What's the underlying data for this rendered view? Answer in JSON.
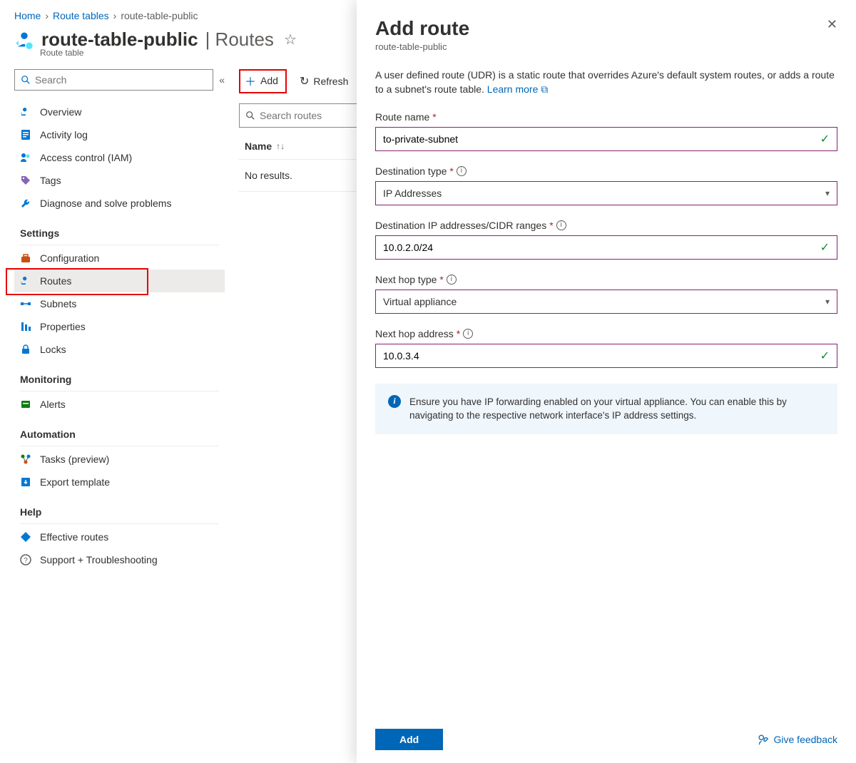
{
  "breadcrumb": {
    "home": "Home",
    "route_tables": "Route tables",
    "current": "route-table-public"
  },
  "header": {
    "title": "route-table-public",
    "divider": " | ",
    "subtitle": "Routes",
    "resource_type": "Route table"
  },
  "sidebar": {
    "search_placeholder": "Search",
    "items": [
      {
        "label": "Overview"
      },
      {
        "label": "Activity log"
      },
      {
        "label": "Access control (IAM)"
      },
      {
        "label": "Tags"
      },
      {
        "label": "Diagnose and solve problems"
      }
    ],
    "settings_header": "Settings",
    "settings": [
      {
        "label": "Configuration"
      },
      {
        "label": "Routes"
      },
      {
        "label": "Subnets"
      },
      {
        "label": "Properties"
      },
      {
        "label": "Locks"
      }
    ],
    "monitoring_header": "Monitoring",
    "monitoring": [
      {
        "label": "Alerts"
      }
    ],
    "automation_header": "Automation",
    "automation": [
      {
        "label": "Tasks (preview)"
      },
      {
        "label": "Export template"
      }
    ],
    "help_header": "Help",
    "help": [
      {
        "label": "Effective routes"
      },
      {
        "label": "Support + Troubleshooting"
      }
    ]
  },
  "toolbar": {
    "add": "Add",
    "refresh": "Refresh",
    "search_placeholder": "Search routes"
  },
  "table": {
    "col_name": "Name",
    "no_results": "No results."
  },
  "panel": {
    "title": "Add route",
    "subtitle": "route-table-public",
    "description": "A user defined route (UDR) is a static route that overrides Azure's default system routes, or adds a route to a subnet's route table. ",
    "learn_more": "Learn more",
    "fields": {
      "route_name": {
        "label": "Route name",
        "value": "to-private-subnet"
      },
      "dest_type": {
        "label": "Destination type",
        "value": "IP Addresses"
      },
      "dest_ip": {
        "label": "Destination IP addresses/CIDR ranges",
        "value": "10.0.2.0/24"
      },
      "next_hop_type": {
        "label": "Next hop type",
        "value": "Virtual appliance"
      },
      "next_hop_addr": {
        "label": "Next hop address",
        "value": "10.0.3.4"
      }
    },
    "notice": "Ensure you have IP forwarding enabled on your virtual appliance. You can enable this by navigating to the respective network interface's IP address settings.",
    "add_button": "Add",
    "feedback": "Give feedback"
  }
}
